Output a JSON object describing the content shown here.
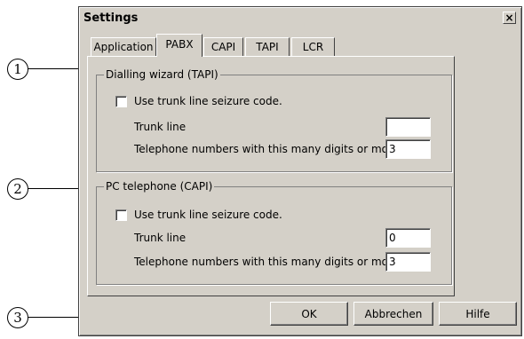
{
  "window": {
    "title": "Settings",
    "close_glyph": "×"
  },
  "tabs": [
    {
      "label": "Application"
    },
    {
      "label": "PABX",
      "active": true
    },
    {
      "label": "CAPI"
    },
    {
      "label": "TAPI"
    },
    {
      "label": "LCR"
    }
  ],
  "groups": {
    "tapi": {
      "title": "Dialling wizard (TAPI)",
      "checkbox_label": "Use trunk line seizure code.",
      "trunk_line_label": "Trunk line",
      "trunk_line_value": "",
      "digits_label": "Telephone numbers with this many digits or more",
      "digits_value": "3"
    },
    "capi": {
      "title": "PC telephone (CAPI)",
      "checkbox_label": "Use trunk line seizure code.",
      "trunk_line_label": "Trunk line",
      "trunk_line_value": "0",
      "digits_label": "Telephone numbers with this many digits or more",
      "digits_value": "3"
    }
  },
  "buttons": {
    "ok": "OK",
    "cancel": "Abbrechen",
    "help": "Hilfe"
  },
  "callouts": [
    "1",
    "2",
    "3"
  ],
  "colors": {
    "dialog_face": "#d4d0c8",
    "shadow": "#808080",
    "highlight": "#ffffff"
  }
}
